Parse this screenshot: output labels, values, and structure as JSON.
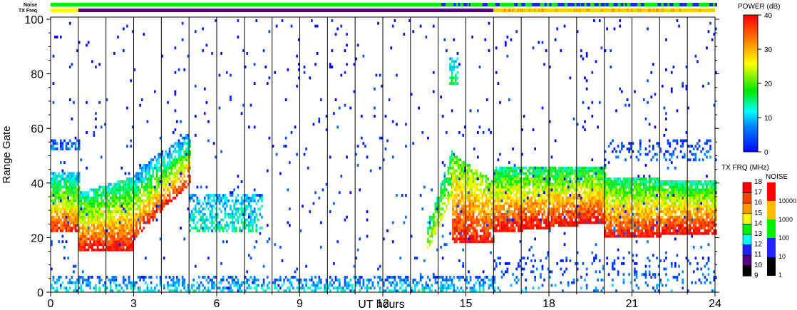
{
  "labels": {
    "noise": "Noise",
    "txfreq": "TX Freq"
  },
  "chart_data": {
    "type": "heatmap",
    "xlabel": "UT hours",
    "ylabel": "Range Gate",
    "xlim": [
      0,
      24
    ],
    "ylim": [
      0,
      100
    ],
    "xticks": [
      "0",
      "3",
      "6",
      "9",
      "12",
      "15",
      "18",
      "21",
      "24"
    ],
    "yticks": [
      "0",
      "20",
      "40",
      "60",
      "80",
      "100"
    ],
    "power_colorbar": {
      "title": "POWER (dB)",
      "range": [
        0,
        40
      ],
      "ticks": [
        "40",
        "30",
        "20",
        "10",
        "0"
      ]
    },
    "txfreq_colorbar": {
      "title": "TX FRQ (MHz)",
      "ticks": [
        "18",
        "17",
        "16",
        "15",
        "14",
        "13",
        "12",
        "11",
        "10",
        "9"
      ]
    },
    "noise_colorbar": {
      "title": "NOISE",
      "ticks": [
        "10000",
        "1000",
        "100",
        "10",
        "1"
      ]
    },
    "regions": [
      {
        "t": [
          0,
          1
        ],
        "lo": [
          22,
          22
        ],
        "hi": [
          44,
          44
        ],
        "p": [
          38,
          8
        ],
        "d": 0.9
      },
      {
        "t": [
          0,
          1
        ],
        "lo": [
          52,
          52
        ],
        "hi": [
          56,
          56
        ],
        "p": [
          6,
          4
        ],
        "d": 0.6
      },
      {
        "t": [
          1,
          3
        ],
        "lo": [
          15,
          15
        ],
        "hi": [
          36,
          42
        ],
        "p": [
          40,
          12
        ],
        "d": 0.9
      },
      {
        "t": [
          3,
          5
        ],
        "lo": [
          20,
          40
        ],
        "hi": [
          44,
          58
        ],
        "p": [
          38,
          6
        ],
        "d": 0.75
      },
      {
        "t": [
          5,
          7.6
        ],
        "lo": [
          22,
          22
        ],
        "hi": [
          36,
          36
        ],
        "p": [
          14,
          8
        ],
        "d": 0.55
      },
      {
        "t": [
          0,
          16
        ],
        "lo": [
          0,
          0
        ],
        "hi": [
          6,
          6
        ],
        "p": [
          12,
          4
        ],
        "d": 0.45
      },
      {
        "t": [
          13.6,
          14.5
        ],
        "lo": [
          16,
          36
        ],
        "hi": [
          26,
          52
        ],
        "p": [
          24,
          14
        ],
        "d": 0.7
      },
      {
        "t": [
          14.4,
          14.7
        ],
        "lo": [
          76,
          76
        ],
        "hi": [
          86,
          86
        ],
        "p": [
          16,
          10
        ],
        "d": 0.6
      },
      {
        "t": [
          14.5,
          16
        ],
        "lo": [
          18,
          18
        ],
        "hi": [
          50,
          40
        ],
        "p": [
          40,
          20
        ],
        "d": 0.85
      },
      {
        "t": [
          16,
          20
        ],
        "lo": [
          22,
          26
        ],
        "hi": [
          46,
          46
        ],
        "p": [
          40,
          14
        ],
        "d": 0.9
      },
      {
        "t": [
          20,
          24
        ],
        "lo": [
          20,
          22
        ],
        "hi": [
          42,
          40
        ],
        "p": [
          40,
          14
        ],
        "d": 0.9
      },
      {
        "t": [
          20,
          24
        ],
        "lo": [
          48,
          48
        ],
        "hi": [
          56,
          56
        ],
        "p": [
          6,
          2
        ],
        "d": 0.25
      },
      {
        "t": [
          16,
          24
        ],
        "lo": [
          0,
          0
        ],
        "hi": [
          14,
          14
        ],
        "p": [
          8,
          2
        ],
        "d": 0.12
      },
      {
        "t": [
          0,
          24
        ],
        "lo": [
          0,
          0
        ],
        "hi": [
          100,
          100
        ],
        "p": [
          4,
          0
        ],
        "d": 0.02
      }
    ],
    "noise_bar": [
      {
        "t": [
          0,
          14
        ],
        "level": "100"
      },
      {
        "t": [
          14,
          24
        ],
        "level": "10-100"
      }
    ],
    "txfreq_bar": [
      {
        "t": [
          0,
          1
        ],
        "mhz": 14
      },
      {
        "t": [
          1,
          16
        ],
        "mhz": 10
      },
      {
        "t": [
          16,
          24
        ],
        "mhz": 14.5
      }
    ]
  }
}
